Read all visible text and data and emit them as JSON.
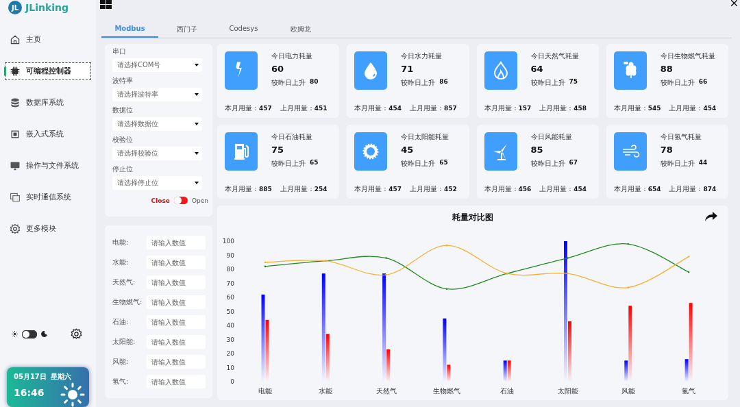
{
  "app": {
    "logo_mark": "JL",
    "name": "JLinking"
  },
  "sidebar": {
    "items": [
      {
        "label": "主页",
        "selected": false
      },
      {
        "label": "可编程控制器",
        "selected": true
      },
      {
        "label": "数据库系统",
        "selected": false
      },
      {
        "label": "嵌入式系统",
        "selected": false
      },
      {
        "label": "操作与文件系统",
        "selected": false
      },
      {
        "label": "实时通信系统",
        "selected": false
      },
      {
        "label": "更多模块",
        "selected": false
      }
    ],
    "dark_mode": false,
    "weather": {
      "date": "05月17日",
      "weekday": "星期六",
      "time": "16:46"
    }
  },
  "tabs": [
    {
      "label": "Modbus",
      "selected": true
    },
    {
      "label": "西门子",
      "selected": false
    },
    {
      "label": "Codesys",
      "selected": false
    },
    {
      "label": "欧姆龙",
      "selected": false
    }
  ],
  "serial": {
    "fields": [
      {
        "label": "串口",
        "placeholder": "请选择COM号"
      },
      {
        "label": "波特率",
        "placeholder": "请选择波特率"
      },
      {
        "label": "数据位",
        "placeholder": "请选择数据位"
      },
      {
        "label": "校验位",
        "placeholder": "请选择校验位"
      },
      {
        "label": "停止位",
        "placeholder": "请选择停止位"
      }
    ],
    "switch": {
      "off_label": "Close",
      "on_label": "Open",
      "on": false
    }
  },
  "inputs": [
    {
      "label": "电能:",
      "placeholder": "请输入数值"
    },
    {
      "label": "水能:",
      "placeholder": "请输入数值"
    },
    {
      "label": "天然气:",
      "placeholder": "请输入数值"
    },
    {
      "label": "生物燃气:",
      "placeholder": "请输入数值"
    },
    {
      "label": "石油:",
      "placeholder": "请输入数值"
    },
    {
      "label": "太阳能:",
      "placeholder": "请输入数值"
    },
    {
      "label": "风能:",
      "placeholder": "请输入数值"
    },
    {
      "label": "氢气:",
      "placeholder": "请输入数值"
    }
  ],
  "cards": [
    {
      "title": "今日电力耗量",
      "value": "60",
      "change_label": "较昨日上升",
      "change": "80",
      "month_label": "本月用量：",
      "month": "457",
      "last_label": "上月用量：",
      "last": "451"
    },
    {
      "title": "今日水力耗量",
      "value": "71",
      "change_label": "较昨日上升",
      "change": "86",
      "month_label": "本月用量：",
      "month": "454",
      "last_label": "上月用量：",
      "last": "857"
    },
    {
      "title": "今日天然气耗量",
      "value": "64",
      "change_label": "较昨日上升",
      "change": "75",
      "month_label": "本月用量：",
      "month": "157",
      "last_label": "上月用量：",
      "last": "458"
    },
    {
      "title": "今日生物燃气耗量",
      "value": "88",
      "change_label": "较昨日上升",
      "change": "66",
      "month_label": "本月用量：",
      "month": "545",
      "last_label": "上月用量：",
      "last": "454"
    },
    {
      "title": "今日石油耗量",
      "value": "75",
      "change_label": "较昨日上升",
      "change": "65",
      "month_label": "本月用量：",
      "month": "885",
      "last_label": "上月用量：",
      "last": "254"
    },
    {
      "title": "今日太阳能耗量",
      "value": "45",
      "change_label": "较昨日上升",
      "change": "65",
      "month_label": "本月用量：",
      "month": "457",
      "last_label": "上月用量：",
      "last": "452"
    },
    {
      "title": "今日风能耗量",
      "value": "85",
      "change_label": "较昨日上升",
      "change": "67",
      "month_label": "本月用量：",
      "month": "456",
      "last_label": "上月用量：",
      "last": "454"
    },
    {
      "title": "今日氢气耗量",
      "value": "78",
      "change_label": "较昨日上升",
      "change": "44",
      "month_label": "本月用量：",
      "month": "654",
      "last_label": "上月用量：",
      "last": "874"
    }
  ],
  "chart": {
    "chart_data": {
      "type": "bar",
      "title": "耗量对比图",
      "categories": [
        "电能",
        "水能",
        "天然气",
        "生物燃气",
        "石油",
        "太阳能",
        "风能",
        "氢气"
      ],
      "ylim": [
        0,
        100
      ],
      "yticks": [
        0,
        10,
        20,
        30,
        40,
        50,
        60,
        70,
        80,
        90,
        100
      ],
      "series": [
        {
          "type": "bar",
          "color": "#0000ff",
          "values": [
            62,
            77,
            77,
            45,
            15,
            100,
            15,
            16
          ]
        },
        {
          "type": "bar",
          "color": "#ff0000",
          "values": [
            44,
            34,
            23,
            12,
            15,
            43,
            54,
            56
          ]
        },
        {
          "type": "line",
          "color": "#228b22",
          "values": [
            82,
            86,
            88,
            66,
            77,
            88,
            98,
            78
          ]
        },
        {
          "type": "line",
          "color": "#f2b233",
          "values": [
            85,
            86,
            76,
            97,
            77,
            77,
            67,
            89
          ]
        }
      ]
    }
  }
}
